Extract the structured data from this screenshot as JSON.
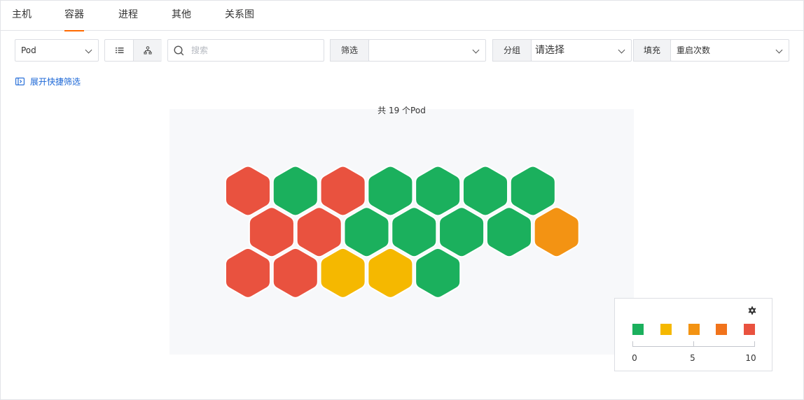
{
  "tabs": [
    {
      "label": "主机",
      "active": false
    },
    {
      "label": "容器",
      "active": true
    },
    {
      "label": "进程",
      "active": false
    },
    {
      "label": "其他",
      "active": false
    },
    {
      "label": "关系图",
      "active": false
    }
  ],
  "toolbar": {
    "object_select": "Pod",
    "view_list_icon": "list-icon",
    "view_graph_icon": "hierarchy-icon",
    "search_placeholder": "搜索",
    "filter_label": "筛选",
    "filter_value": "",
    "group_label": "分组",
    "group_value": "请选择",
    "fill_label": "填充",
    "fill_value": "重启次数"
  },
  "quick_filter": {
    "icon": "expand-panel-icon",
    "label": "展开快捷筛选"
  },
  "colors": {
    "accent": "#ff6a00",
    "link": "#1a66d6",
    "green": "#1bb05d",
    "yellow": "#f5b800",
    "orange": "#f39313",
    "deep_orange": "#f1731b",
    "red": "#e9523f"
  },
  "chart_data": {
    "type": "heatmap",
    "title": "共 19 个Pod",
    "layout": "honeycomb",
    "rows": [
      [
        "red",
        "green",
        "red",
        "green",
        "green",
        "green",
        "green"
      ],
      [
        "red",
        "red",
        "green",
        "green",
        "green",
        "green",
        "orange"
      ],
      [
        "red",
        "red",
        "yellow",
        "yellow",
        "green"
      ]
    ],
    "legend": {
      "colors": [
        "green",
        "yellow",
        "orange",
        "deep_orange",
        "red"
      ],
      "ticks": [
        "0",
        "5",
        "10"
      ],
      "range": [
        0,
        10
      ],
      "settings_icon": "gear-icon"
    }
  }
}
